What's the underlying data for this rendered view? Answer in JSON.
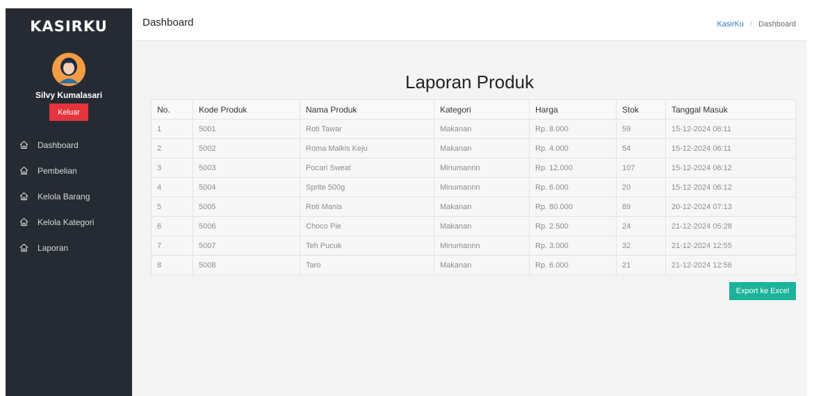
{
  "sidebar": {
    "brand": "KASIRKU",
    "user_name": "Silvy Kumalasari",
    "logout_label": "Keluar",
    "items": [
      {
        "label": "Dashboard",
        "icon": "home-icon"
      },
      {
        "label": "Pembelian",
        "icon": "home-icon"
      },
      {
        "label": "Kelola Barang",
        "icon": "home-icon"
      },
      {
        "label": "Kelola Kategori",
        "icon": "home-icon"
      },
      {
        "label": "Laporan",
        "icon": "home-icon"
      }
    ]
  },
  "header": {
    "title": "Dashboard",
    "breadcrumb": [
      "KasirKu",
      "Dashboard"
    ]
  },
  "main": {
    "title": "Laporan Produk",
    "columns": [
      "No.",
      "Kode Produk",
      "Nama Produk",
      "Kategori",
      "Harga",
      "Stok",
      "Tanggal Masuk"
    ],
    "rows": [
      [
        "1",
        "5001",
        "Roti Tawar",
        "Makanan",
        "Rp. 8.000",
        "59",
        "15-12-2024 06:11"
      ],
      [
        "2",
        "5002",
        "Roma Malkis Keju",
        "Makanan",
        "Rp. 4.000",
        "54",
        "15-12-2024 06:11"
      ],
      [
        "3",
        "5003",
        "Pocari Sweat",
        "Minumannn",
        "Rp. 12.000",
        "107",
        "15-12-2024 06:12"
      ],
      [
        "4",
        "5004",
        "Sprite 500g",
        "Minumannn",
        "Rp. 6.000",
        "20",
        "15-12-2024 06:12"
      ],
      [
        "5",
        "5005",
        "Roti Manis",
        "Makanan",
        "Rp. 80.000",
        "89",
        "20-12-2024 07:13"
      ],
      [
        "6",
        "5006",
        "Choco Pie",
        "Makanan",
        "Rp. 2.500",
        "24",
        "21-12-2024 05:28"
      ],
      [
        "7",
        "5007",
        "Teh Pucuk",
        "Minumannn",
        "Rp. 3.000",
        "32",
        "21-12-2024 12:55"
      ],
      [
        "8",
        "5008",
        "Taro",
        "Makanan",
        "Rp. 6.000",
        "21",
        "21-12-2024 12:56"
      ]
    ],
    "export_label": "Export ke Excel"
  },
  "colors": {
    "sidebar_bg": "#262b33",
    "logout_red": "#e5343d",
    "export_teal": "#1bb39a",
    "link_blue": "#2b7bc0"
  }
}
